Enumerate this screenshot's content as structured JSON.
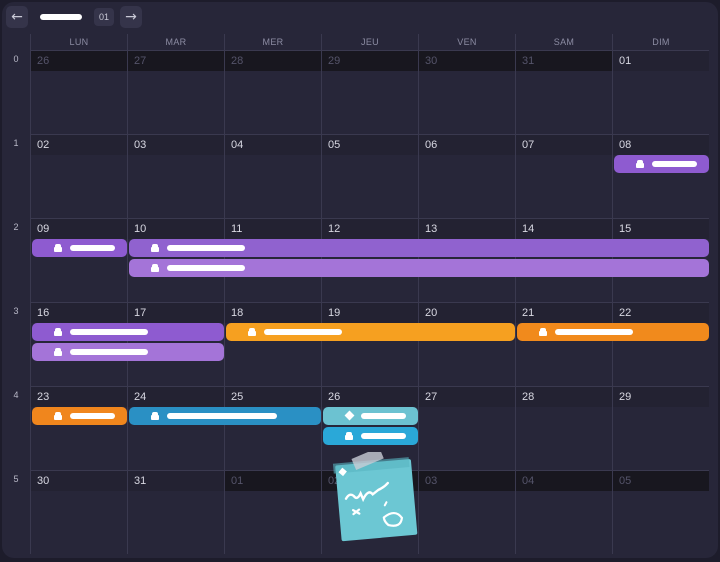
{
  "nav": {
    "prev_icon": "arrow-left-icon",
    "next_icon": "arrow-right-icon",
    "month_badge": "01"
  },
  "weekdays": [
    "LUN",
    "MAR",
    "MER",
    "JEU",
    "VEN",
    "SAM",
    "DIM"
  ],
  "weeks": [
    {
      "number": "0",
      "days": [
        {
          "label": "26",
          "other": true
        },
        {
          "label": "27",
          "other": true
        },
        {
          "label": "28",
          "other": true
        },
        {
          "label": "29",
          "other": true
        },
        {
          "label": "30",
          "other": true
        },
        {
          "label": "31",
          "other": true
        },
        {
          "label": "01",
          "other": false
        }
      ]
    },
    {
      "number": "1",
      "days": [
        {
          "label": "02",
          "other": false
        },
        {
          "label": "03",
          "other": false
        },
        {
          "label": "04",
          "other": false
        },
        {
          "label": "05",
          "other": false
        },
        {
          "label": "06",
          "other": false
        },
        {
          "label": "07",
          "other": false
        },
        {
          "label": "08",
          "other": false
        }
      ]
    },
    {
      "number": "2",
      "days": [
        {
          "label": "09",
          "other": false
        },
        {
          "label": "10",
          "other": false
        },
        {
          "label": "11",
          "other": false
        },
        {
          "label": "12",
          "other": false
        },
        {
          "label": "13",
          "other": false
        },
        {
          "label": "14",
          "other": false
        },
        {
          "label": "15",
          "other": false
        }
      ]
    },
    {
      "number": "3",
      "days": [
        {
          "label": "16",
          "other": false
        },
        {
          "label": "17",
          "other": false
        },
        {
          "label": "18",
          "other": false
        },
        {
          "label": "19",
          "other": false
        },
        {
          "label": "20",
          "other": false
        },
        {
          "label": "21",
          "other": false
        },
        {
          "label": "22",
          "other": false
        }
      ]
    },
    {
      "number": "4",
      "days": [
        {
          "label": "23",
          "other": false
        },
        {
          "label": "24",
          "other": false
        },
        {
          "label": "25",
          "other": false
        },
        {
          "label": "26",
          "other": false
        },
        {
          "label": "27",
          "other": false
        },
        {
          "label": "28",
          "other": false
        },
        {
          "label": "29",
          "other": false
        }
      ]
    },
    {
      "number": "5",
      "days": [
        {
          "label": "30",
          "other": false
        },
        {
          "label": "31",
          "other": false
        },
        {
          "label": "01",
          "other": true
        },
        {
          "label": "02",
          "other": true
        },
        {
          "label": "03",
          "other": true
        },
        {
          "label": "04",
          "other": true
        },
        {
          "label": "05",
          "other": true
        }
      ]
    }
  ],
  "events": [
    {
      "week": 1,
      "start": 6,
      "span": 1,
      "lane": 0,
      "color": "#8e5bd0",
      "icon": "lock-icon"
    },
    {
      "week": 2,
      "start": 0,
      "span": 1,
      "lane": 0,
      "color": "#8e5bd0",
      "icon": "lock-icon"
    },
    {
      "week": 2,
      "start": 1,
      "span": 6,
      "lane": 0,
      "color": "#9062cf",
      "icon": "lock-icon"
    },
    {
      "week": 2,
      "start": 1,
      "span": 6,
      "lane": 1,
      "color": "#a474d8",
      "icon": "lock-icon"
    },
    {
      "week": 3,
      "start": 0,
      "span": 2,
      "lane": 0,
      "color": "#8e5bd0",
      "icon": "lock-icon"
    },
    {
      "week": 3,
      "start": 0,
      "span": 2,
      "lane": 1,
      "color": "#a474d8",
      "icon": "lock-icon"
    },
    {
      "week": 3,
      "start": 2,
      "span": 3,
      "lane": 0,
      "color": "#f6a020",
      "icon": "lock-icon"
    },
    {
      "week": 3,
      "start": 5,
      "span": 2,
      "lane": 0,
      "color": "#f18a1c",
      "icon": "lock-icon"
    },
    {
      "week": 4,
      "start": 0,
      "span": 1,
      "lane": 0,
      "color": "#f0861d",
      "icon": "lock-icon"
    },
    {
      "week": 4,
      "start": 1,
      "span": 2,
      "lane": 0,
      "color": "#2a90c4",
      "icon": "lock-icon"
    },
    {
      "week": 4,
      "start": 3,
      "span": 1,
      "lane": 0,
      "color": "#6cc2d1",
      "icon": "diamond-icon"
    },
    {
      "week": 4,
      "start": 3,
      "span": 1,
      "lane": 1,
      "color": "#2aa8d8",
      "icon": "lock-icon"
    }
  ],
  "sticky_note": {
    "icon": "sticky-note-icon",
    "color": "#6cc7d3",
    "tape_color": "#c9cdd6"
  }
}
